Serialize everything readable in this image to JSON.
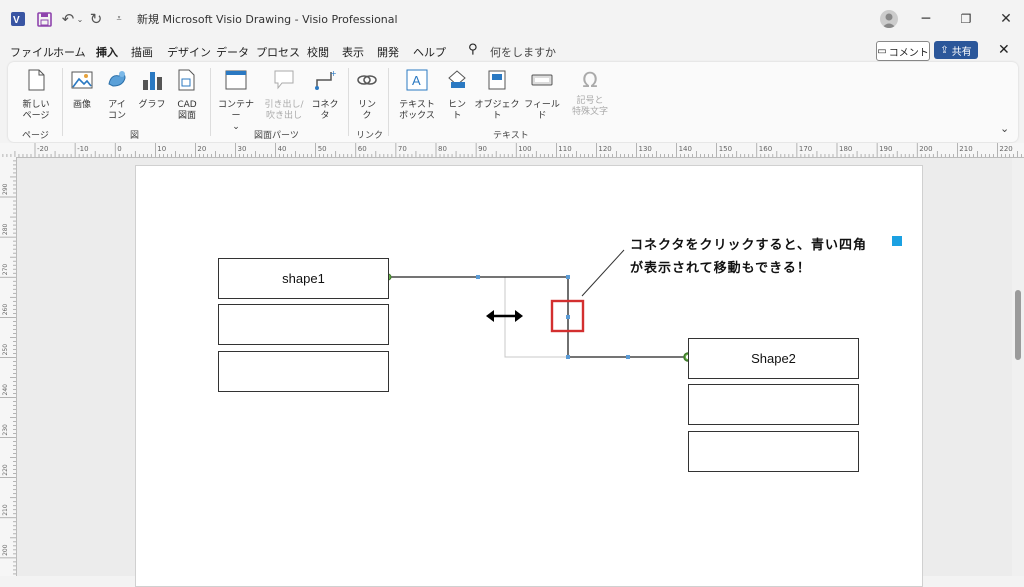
{
  "titlebar": {
    "title": "新規 Microsoft Visio Drawing  -  Visio Professional",
    "app_icon": "visio-icon",
    "save_icon": "save-icon",
    "undo_icon": "undo-icon",
    "redo_icon": "redo-icon"
  },
  "menu": {
    "items": [
      "ファイル",
      "ホーム",
      "挿入",
      "描画",
      "デザイン",
      "データ",
      "プロセス",
      "校閲",
      "表示",
      "開発",
      "ヘルプ"
    ],
    "active": "挿入",
    "search_placeholder": "何をしますか",
    "comment_label": "コメント",
    "share_label": "共有"
  },
  "ribbon": {
    "new_page": "新しい\nページ",
    "image": "画像",
    "icon": "アイ\nコン",
    "graph": "グラフ",
    "cad": "CAD\n図面",
    "container": "コンテナー",
    "callout": "引き出し/\n吹き出し",
    "connector": "コネクタ",
    "link": "リン\nク",
    "textbox": "テキスト\nボックス",
    "hint": "ヒント",
    "object": "オブジェクト",
    "field": "フィールド",
    "symbol": "記号と\n特殊文字",
    "groups": [
      "ページ",
      "図",
      "図面パーツ",
      "リンク",
      "テキスト"
    ]
  },
  "ruler": {
    "h_ticks": [
      "-20",
      "-10",
      "0",
      "10",
      "20",
      "30",
      "40",
      "50",
      "60",
      "70",
      "80",
      "90",
      "100",
      "110",
      "120",
      "130",
      "140",
      "150",
      "160",
      "170",
      "180",
      "190",
      "200",
      "210",
      "220"
    ],
    "v_ticks": [
      "290",
      "280",
      "270",
      "260",
      "250",
      "240",
      "230",
      "220",
      "210",
      "200",
      "190"
    ]
  },
  "diagram": {
    "shape1_label": "shape1",
    "shape2_label": "Shape2",
    "annotation_line1": "コネクタをクリックすると、青い四角",
    "annotation_line2": "が表示されて移動もできる！",
    "accent_color": "#1ba1e2",
    "highlight_color": "#d32f2f"
  }
}
